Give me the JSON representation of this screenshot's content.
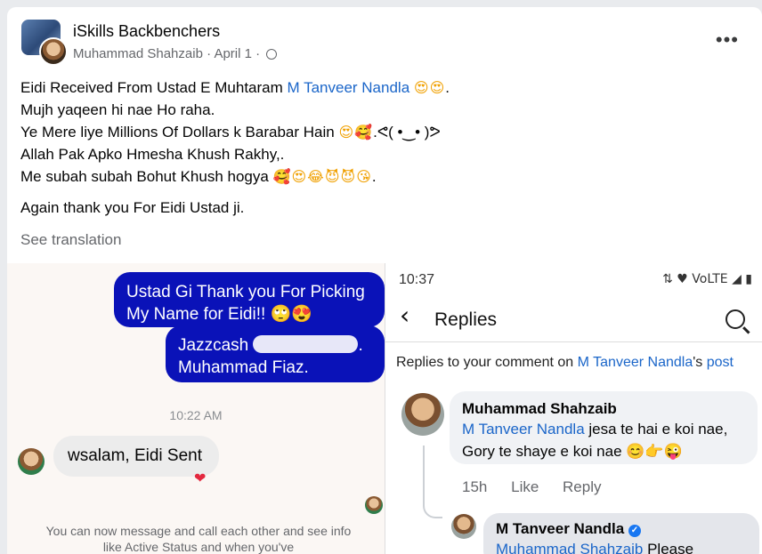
{
  "post": {
    "group_name": "iSkills Backbenchers",
    "author": "Muhammad Shahzaib",
    "date": "April 1",
    "more_label": "•••",
    "see_translation": "See translation",
    "lines": {
      "l1_pre": "Eidi Received From Ustad E Muhtaram ",
      "l1_mention": "M Tanveer Nandla",
      "l1_emoji": "😍😍",
      "l1_post": ".",
      "l2": "Mujh yaqeen hi nae Ho raha.",
      "l3_pre": "Ye Mere liye Millions Of Dollars k Barabar Hain ",
      "l3_emoji": "😍🥰",
      "l3_post": ".ᕙ( •‿• )ᕗ",
      "l4": "Allah Pak Apko Hmesha Khush Rakhy,.",
      "l5_pre": " Me subah subah Bohut Khush hogya ",
      "l5_emoji": "🥰😍😂😈😈😘",
      "l5_post": ".",
      "l6": "Again thank you For Eidi Ustad ji."
    }
  },
  "chat": {
    "msg1": "Ustad Gi Thank you For Picking My Name for Eidi!! 🙄😍",
    "msg2_pre": "Jazzcash ",
    "msg2_post": ".",
    "msg2_line2": "Muhammad Fiaz.",
    "time": "10:22 AM",
    "reply": "wsalam, Eidi Sent",
    "reaction": "❤",
    "info": "You can now message and call each other and see info like Active Status and when you've"
  },
  "replies_screen": {
    "status_time": "10:37",
    "status_icons": "⇅ ♥ VoLTE ◢ ▮",
    "title": "Replies",
    "replies_to_pre": "Replies to your comment on ",
    "replies_to_name": "M Tanveer Nandla",
    "replies_to_mid": "'s ",
    "replies_to_post": "post",
    "comment_author": "Muhammad Shahzaib",
    "comment_mention": "M Tanveer Nandla",
    "comment_text": " jesa te hai e koi nae, Gory te shaye e koi nae 😊👉😜",
    "comment_time": "15h",
    "like_label": "Like",
    "reply_label": "Reply",
    "reply_author": "M Tanveer Nandla",
    "reply_mention": "Muhammad Shahzaib",
    "reply_text": " Please"
  },
  "colors": {
    "accent": "#1b66c9",
    "chat_blue": "#0a12b8"
  }
}
